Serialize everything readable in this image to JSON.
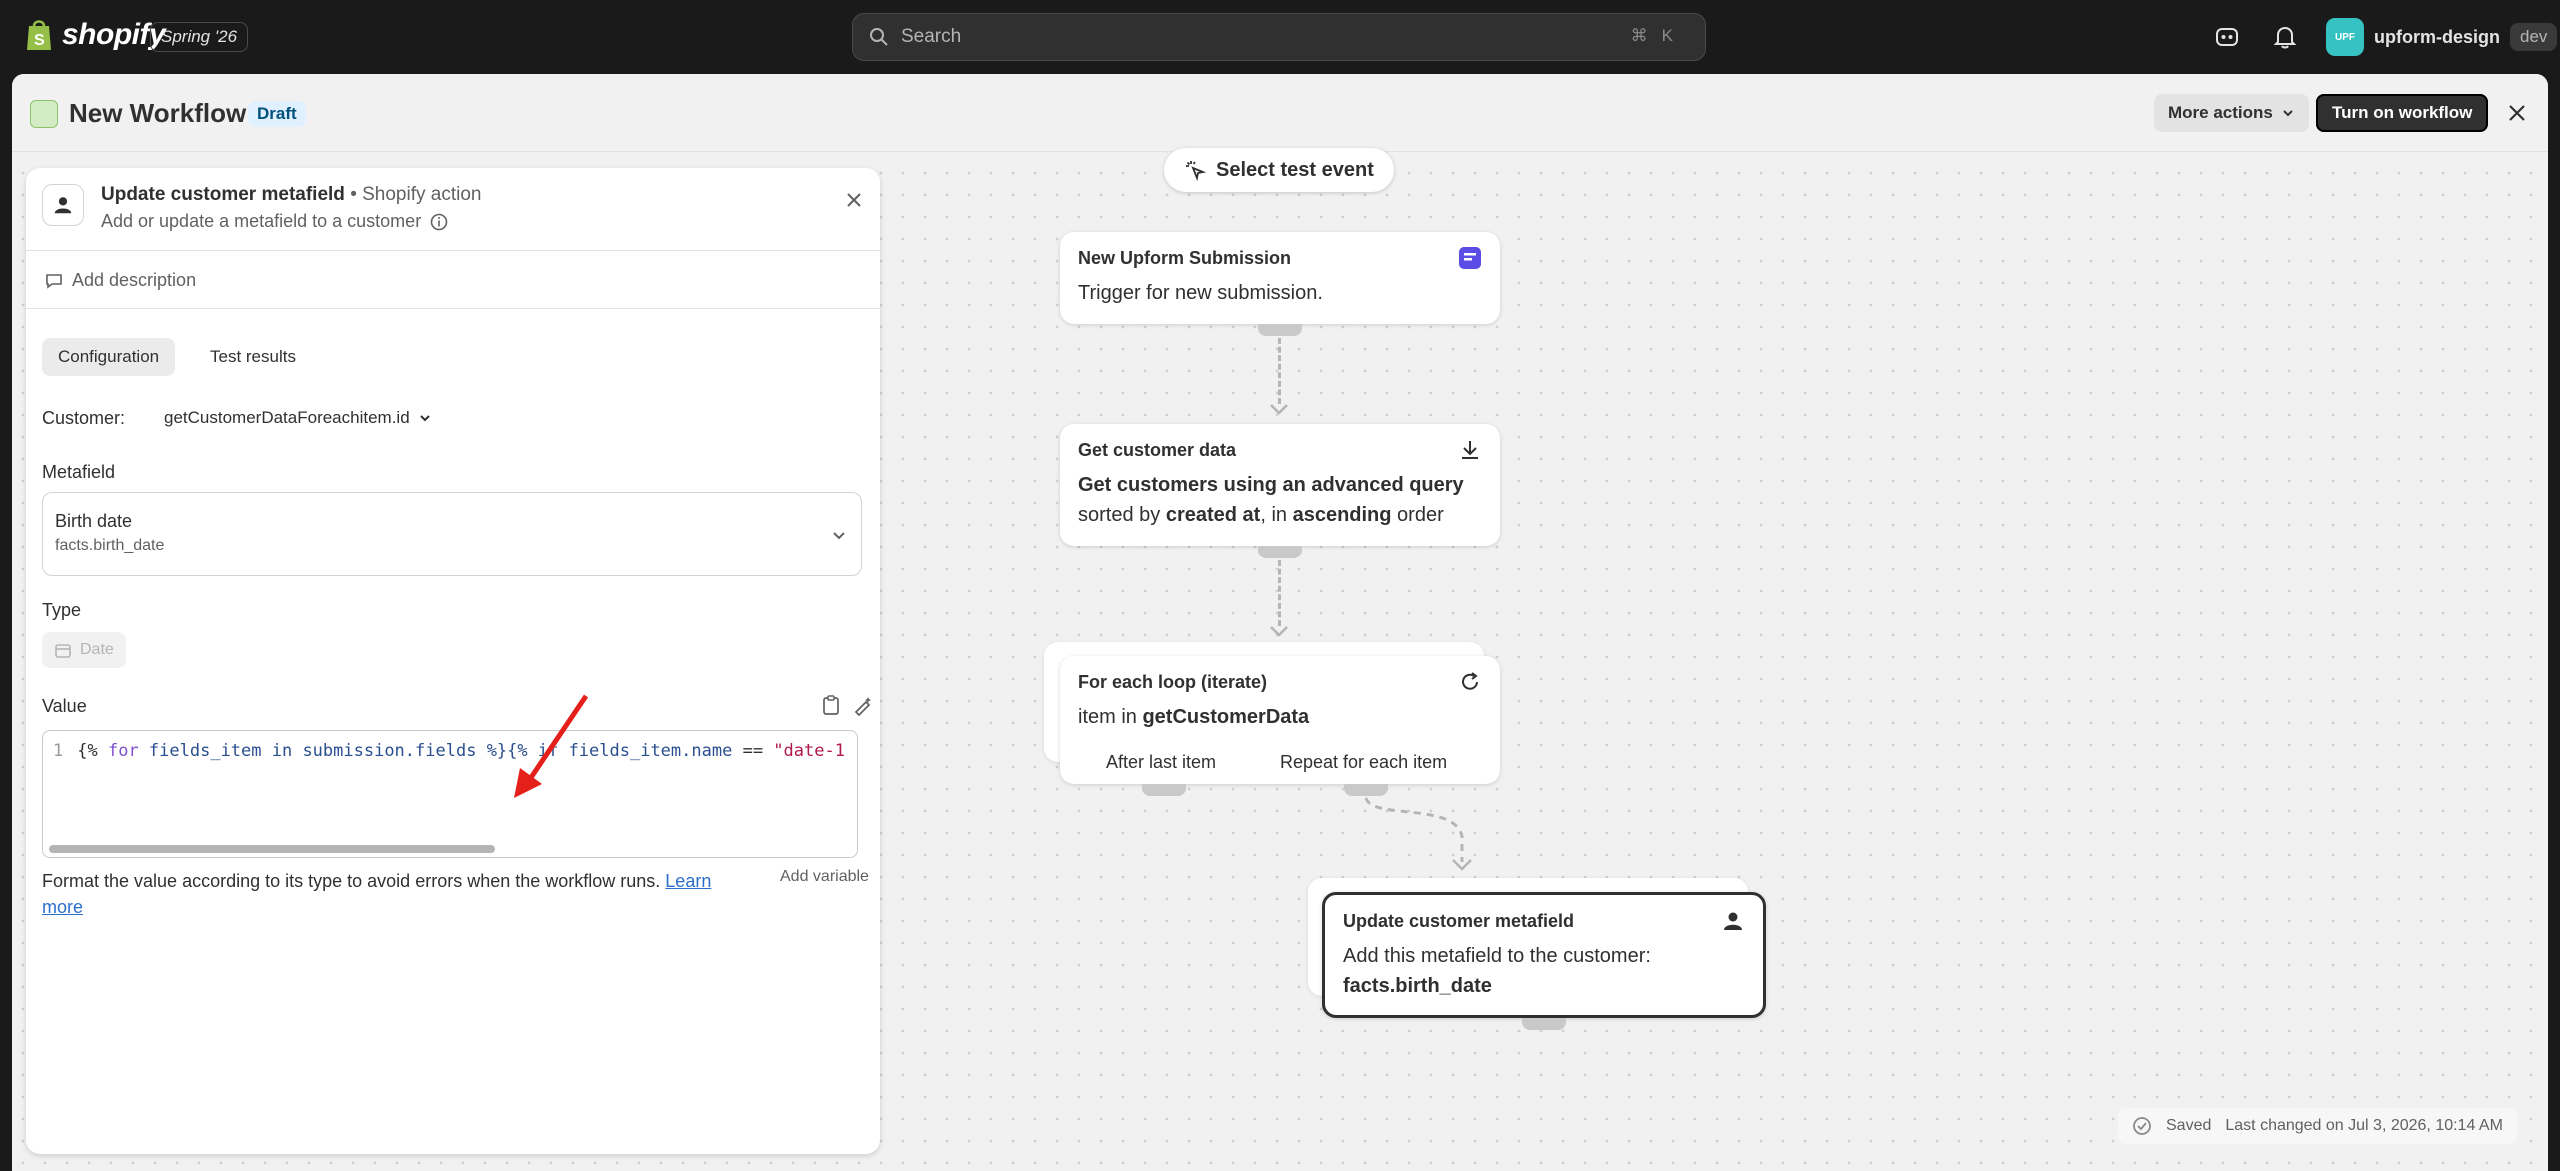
{
  "topbar": {
    "brand": "shopify",
    "edition": "Spring '26",
    "search_placeholder": "Search",
    "shortcut_cmd": "⌘",
    "shortcut_key": "K",
    "store_avatar": "UPF",
    "store_name": "upform-design",
    "store_env": "dev"
  },
  "header": {
    "title": "New Workflow",
    "status": "Draft",
    "more_actions": "More actions",
    "turn_on": "Turn on workflow"
  },
  "panel": {
    "title": "Update customer metafield",
    "title_sub": "Shopify action",
    "description": "Add or update a metafield to a customer",
    "add_description": "Add description",
    "tabs": [
      "Configuration",
      "Test results"
    ],
    "customer_label": "Customer:",
    "customer_value": "getCustomerDataForeachitem.id",
    "metafield_label": "Metafield",
    "metafield_name": "Birth date",
    "metafield_key": "facts.birth_date",
    "type_label": "Type",
    "type_value": "Date",
    "value_label": "Value",
    "code": {
      "line_number": "1",
      "t1": "{% ",
      "t2": "for",
      "t3": " fields_item in submission",
      "t4": ".fields",
      "t5": " %}{% if fields_item",
      "t6": ".name",
      "t7": " == ",
      "t8": "\"date-1"
    },
    "help_text": "Format the value according to its type to avoid errors when the workflow runs. ",
    "help_link": "Learn more",
    "add_variable": "Add variable"
  },
  "canvas": {
    "select_test_event": "Select test event",
    "nodes": {
      "trigger": {
        "title": "New Upform Submission",
        "body": "Trigger for new submission."
      },
      "get_data": {
        "title": "Get customer data",
        "b1": "Get customers using an advanced query",
        "b2a": "sorted by ",
        "b2b": "created at",
        "b2c": ", in ",
        "b2d": "ascending",
        "b2e": " order"
      },
      "loop": {
        "title": "For each loop (iterate)",
        "b1": "item in ",
        "b2": "getCustomerData",
        "after": "After last item",
        "repeat": "Repeat for each item"
      },
      "update": {
        "title": "Update customer metafield",
        "b1": "Add this metafield to the customer:",
        "b2": "facts.birth_date"
      }
    },
    "saved": "Saved",
    "last_changed": "Last changed on Jul 3, 2026, 10:14 AM"
  },
  "colors": {
    "accent_blue": "#2c6ecb",
    "draft_badge": "#e0f0ff",
    "primary_button": "#303030"
  }
}
